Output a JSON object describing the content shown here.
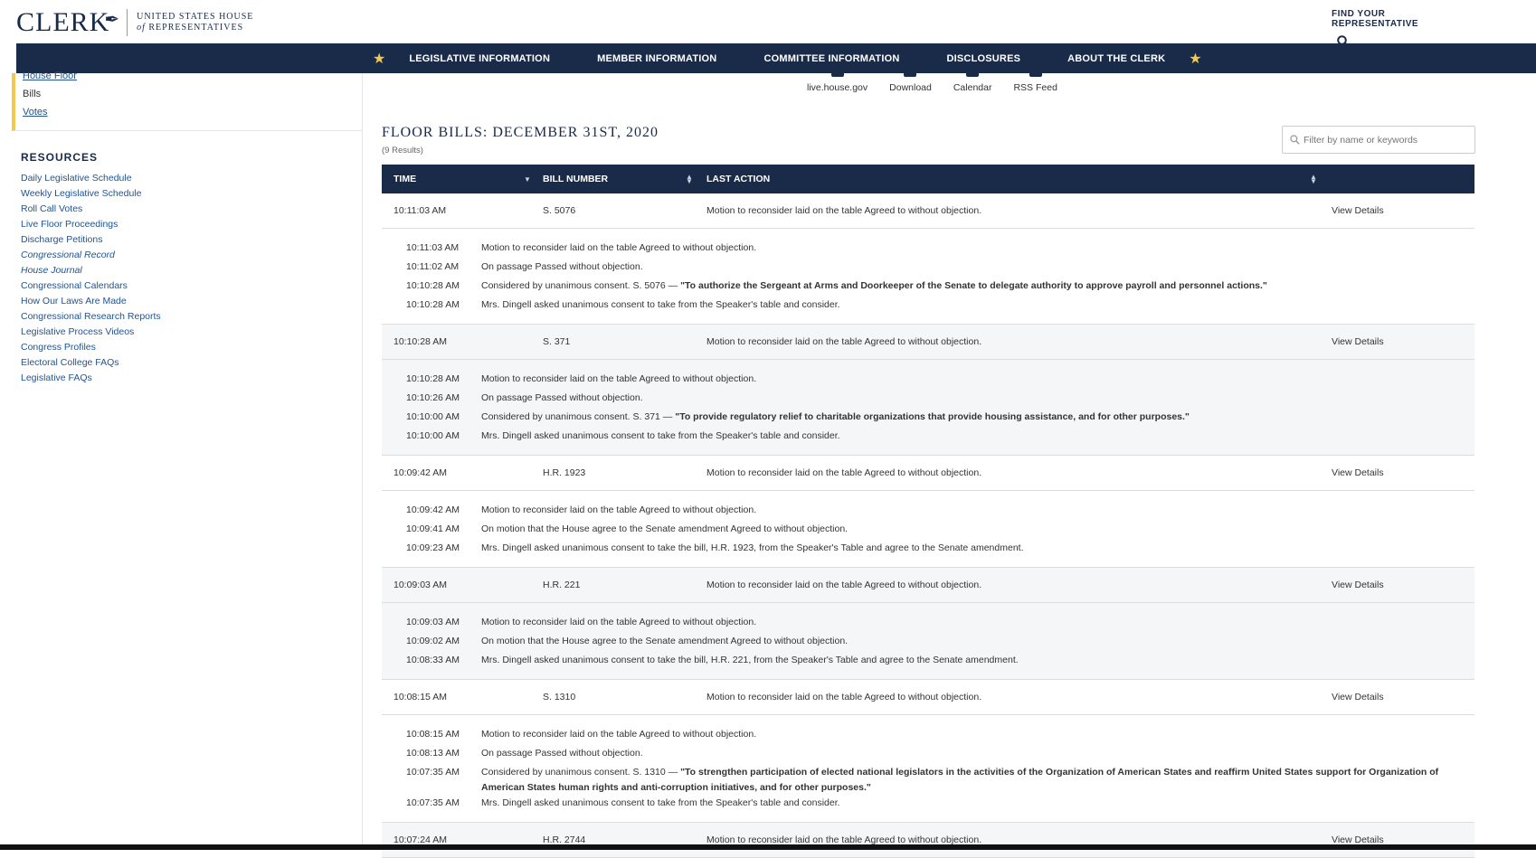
{
  "header": {
    "logo_word": "CLERK",
    "logo_line1": "UNITED STATES HOUSE",
    "logo_of": "of",
    "logo_line2": "REPRESENTATIVES",
    "find_label": "FIND YOUR REPRESENTATIVE"
  },
  "nav": {
    "items": [
      "LEGISLATIVE INFORMATION",
      "MEMBER INFORMATION",
      "COMMITTEE INFORMATION",
      "DISCLOSURES",
      "ABOUT THE CLERK"
    ]
  },
  "sidebar": {
    "floor_links": [
      "House Floor",
      "Bills",
      "Votes"
    ],
    "resources_title": "RESOURCES",
    "resources": [
      "Daily Legislative Schedule",
      "Weekly Legislative Schedule",
      "Roll Call Votes",
      "Live Floor Proceedings",
      "Discharge Petitions",
      "Congressional Record",
      "House Journal",
      "Congressional Calendars",
      "How Our Laws Are Made",
      "Congressional Research Reports",
      "Legislative Process Videos",
      "Congress Profiles",
      "Electoral College FAQs",
      "Legislative FAQs"
    ]
  },
  "tools": [
    "live.house.gov",
    "Download",
    "Calendar",
    "RSS Feed"
  ],
  "main": {
    "title": "FLOOR BILLS: DECEMBER 31ST, 2020",
    "results": "(9 Results)",
    "filter_placeholder": "Filter by name or keywords"
  },
  "table": {
    "headers": [
      "TIME",
      "BILL NUMBER",
      "LAST ACTION"
    ],
    "view_label": "View Details",
    "bills": [
      {
        "time": "10:11:03 AM",
        "bill": "S. 5076",
        "last_action": "Motion to reconsider laid on the table Agreed to without objection.",
        "actions": [
          {
            "time": "10:11:03 AM",
            "pre": "Motion to reconsider laid on the table Agreed to without objection.",
            "bold": ""
          },
          {
            "time": "10:11:02 AM",
            "pre": "On passage Passed without objection.",
            "bold": ""
          },
          {
            "time": "10:10:28 AM",
            "pre": "Considered by unanimous consent. S. 5076 — ",
            "bold": "\"To authorize the Sergeant at Arms and Doorkeeper of the Senate to delegate authority to approve payroll and personnel actions.\""
          },
          {
            "time": "10:10:28 AM",
            "pre": "Mrs. Dingell asked unanimous consent to take from the Speaker's table and consider.",
            "bold": ""
          }
        ]
      },
      {
        "time": "10:10:28 AM",
        "bill": "S. 371",
        "last_action": "Motion to reconsider laid on the table Agreed to without objection.",
        "actions": [
          {
            "time": "10:10:28 AM",
            "pre": "Motion to reconsider laid on the table Agreed to without objection.",
            "bold": ""
          },
          {
            "time": "10:10:26 AM",
            "pre": "On passage Passed without objection.",
            "bold": ""
          },
          {
            "time": "10:10:00 AM",
            "pre": "Considered by unanimous consent. S. 371 — ",
            "bold": "\"To provide regulatory relief to charitable organizations that provide housing assistance, and for other purposes.\""
          },
          {
            "time": "10:10:00 AM",
            "pre": "Mrs. Dingell asked unanimous consent to take from the Speaker's table and consider.",
            "bold": ""
          }
        ]
      },
      {
        "time": "10:09:42 AM",
        "bill": "H.R. 1923",
        "last_action": "Motion to reconsider laid on the table Agreed to without objection.",
        "actions": [
          {
            "time": "10:09:42 AM",
            "pre": "Motion to reconsider laid on the table Agreed to without objection.",
            "bold": ""
          },
          {
            "time": "10:09:41 AM",
            "pre": "On motion that the House agree to the Senate amendment Agreed to without objection.",
            "bold": ""
          },
          {
            "time": "10:09:23 AM",
            "pre": "Mrs. Dingell asked unanimous consent to take the bill, H.R. 1923, from the Speaker's Table and agree to the Senate amendment.",
            "bold": ""
          }
        ]
      },
      {
        "time": "10:09:03 AM",
        "bill": "H.R. 221",
        "last_action": "Motion to reconsider laid on the table Agreed to without objection.",
        "actions": [
          {
            "time": "10:09:03 AM",
            "pre": "Motion to reconsider laid on the table Agreed to without objection.",
            "bold": ""
          },
          {
            "time": "10:09:02 AM",
            "pre": "On motion that the House agree to the Senate amendment Agreed to without objection.",
            "bold": ""
          },
          {
            "time": "10:08:33 AM",
            "pre": "Mrs. Dingell asked unanimous consent to take the bill, H.R. 221, from the Speaker's Table and agree to the Senate amendment.",
            "bold": ""
          }
        ]
      },
      {
        "time": "10:08:15 AM",
        "bill": "S. 1310",
        "last_action": "Motion to reconsider laid on the table Agreed to without objection.",
        "actions": [
          {
            "time": "10:08:15 AM",
            "pre": "Motion to reconsider laid on the table Agreed to without objection.",
            "bold": ""
          },
          {
            "time": "10:08:13 AM",
            "pre": "On passage Passed without objection.",
            "bold": ""
          },
          {
            "time": "10:07:35 AM",
            "pre": "Considered by unanimous consent. S. 1310 — ",
            "bold": "\"To strengthen participation of elected national legislators in the activities of the Organization of American States and reaffirm United States support for Organization of American States human rights and anti-corruption initiatives, and for other purposes.\""
          },
          {
            "time": "10:07:35 AM",
            "pre": "Mrs. Dingell asked unanimous consent to take from the Speaker's table and consider.",
            "bold": ""
          }
        ]
      },
      {
        "time": "10:07:24 AM",
        "bill": "H.R. 2744",
        "last_action": "Motion to reconsider laid on the table Agreed to without objection.",
        "actions": []
      }
    ]
  }
}
